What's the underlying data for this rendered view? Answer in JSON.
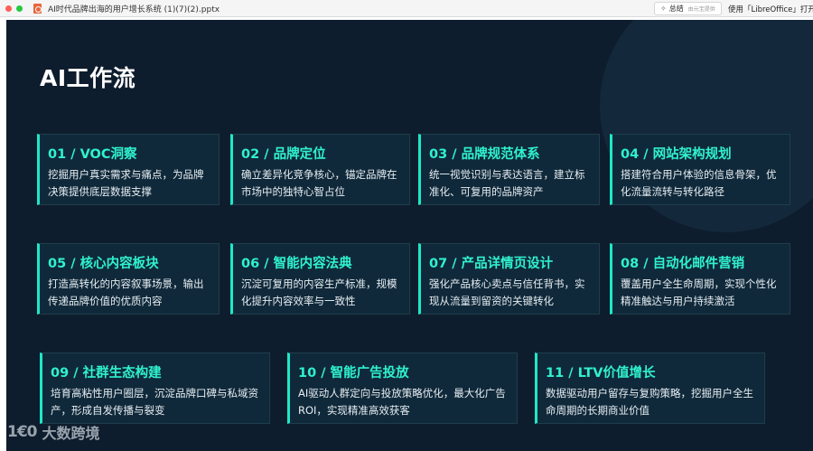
{
  "window": {
    "filename": "AI时代品牌出海的用户增长系统 (1)(7)(2).pptx",
    "summary_button": {
      "label": "总结",
      "sublabel": "由元宝提供"
    },
    "open_with_label": "使用「LibreOffice」打开"
  },
  "slide": {
    "title": "AI工作流",
    "cards": [
      {
        "title": "01 / VOC洞察",
        "desc": "挖掘用户真实需求与痛点，为品牌决策提供底层数据支撑"
      },
      {
        "title": "02 / 品牌定位",
        "desc": "确立差异化竞争核心，锚定品牌在市场中的独特心智占位"
      },
      {
        "title": "03 / 品牌规范体系",
        "desc": "统一视觉识别与表达语言，建立标准化、可复用的品牌资产"
      },
      {
        "title": "04 / 网站架构规划",
        "desc": "搭建符合用户体验的信息骨架，优化流量流转与转化路径"
      },
      {
        "title": "05 / 核心内容板块",
        "desc": "打造高转化的内容叙事场景，输出传递品牌价值的优质内容"
      },
      {
        "title": "06 / 智能内容法典",
        "desc": "沉淀可复用的内容生产标准，规模化提升内容效率与一致性"
      },
      {
        "title": "07 / 产品详情页设计",
        "desc": "强化产品核心卖点与信任背书，实现从流量到留资的关键转化"
      },
      {
        "title": "08 / 自动化邮件营销",
        "desc": "覆盖用户全生命周期，实现个性化精准触达与用户持续激活"
      },
      {
        "title": "09 / 社群生态构建",
        "desc": "培育高粘性用户圈层，沉淀品牌口碑与私域资产，形成自发传播与裂变"
      },
      {
        "title": "10 / 智能广告投放",
        "desc": "AI驱动人群定向与投放策略优化，最大化广告ROI，实现精准高效获客"
      },
      {
        "title": "11 / LTV价值增长",
        "desc": "数据驱动用户留存与复购策略，挖掘用户全生命周期的长期商业价值"
      }
    ],
    "watermark": {
      "logo": "1€0",
      "text": "大数跨境"
    }
  }
}
